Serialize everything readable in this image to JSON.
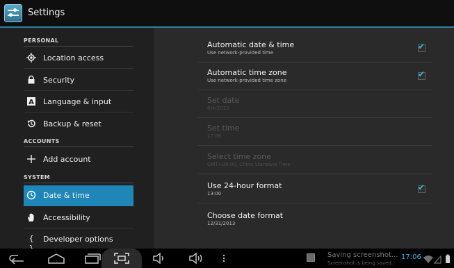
{
  "actionbar": {
    "title": "Settings",
    "icon": "settings-sliders-icon"
  },
  "sidebar": {
    "sections": [
      {
        "label": "PERSONAL"
      },
      {
        "label": "ACCOUNTS"
      },
      {
        "label": "SYSTEM"
      }
    ],
    "items": [
      {
        "label": "Location access",
        "icon": "location-icon"
      },
      {
        "label": "Security",
        "icon": "lock-icon"
      },
      {
        "label": "Language & input",
        "icon": "keyboard-a-icon"
      },
      {
        "label": "Backup & reset",
        "icon": "backup-restore-icon"
      },
      {
        "label": "Add account",
        "icon": "plus-icon"
      },
      {
        "label": "Date & time",
        "icon": "clock-icon",
        "selected": true
      },
      {
        "label": "Accessibility",
        "icon": "hand-icon"
      },
      {
        "label": "Developer options",
        "icon": "braces-icon"
      }
    ]
  },
  "detail": {
    "prefs": [
      {
        "title": "Automatic date & time",
        "summary": "Use network-provided time",
        "checked": true,
        "enabled": true
      },
      {
        "title": "Automatic time zone",
        "summary": "Use network-provided time zone",
        "checked": true,
        "enabled": true
      },
      {
        "title": "Set date",
        "summary": "6/4/2013",
        "enabled": false
      },
      {
        "title": "Set time",
        "summary": "17:06",
        "enabled": false
      },
      {
        "title": "Select time zone",
        "summary": "GMT+08:00, China Standard Time",
        "enabled": false
      },
      {
        "title": "Use 24-hour format",
        "summary": "13:00",
        "checked": true,
        "enabled": true
      },
      {
        "title": "Choose date format",
        "summary": "12/31/2013",
        "enabled": true
      }
    ]
  },
  "navbar": {
    "notification": {
      "title": "Saving screenshot...",
      "text": "Screenshot is being saved."
    },
    "clock": "17:06",
    "accent": "#33b5e5"
  }
}
